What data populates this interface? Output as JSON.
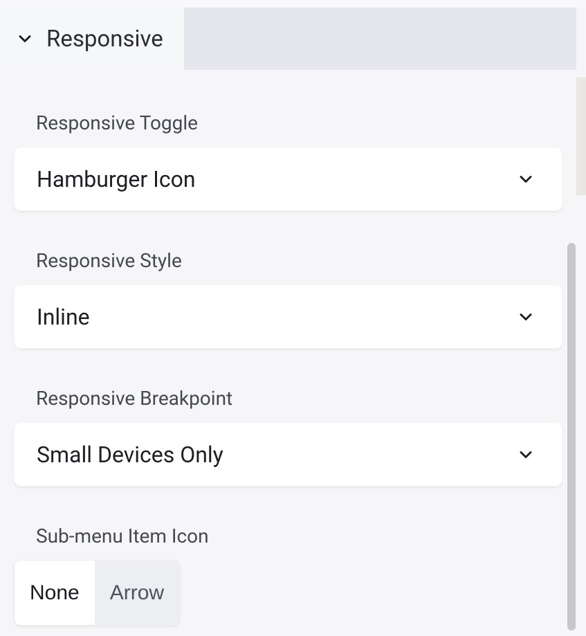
{
  "tab": {
    "label": "Responsive"
  },
  "fields": {
    "toggle": {
      "label": "Responsive Toggle",
      "value": "Hamburger Icon"
    },
    "style": {
      "label": "Responsive Style",
      "value": "Inline"
    },
    "breakpoint": {
      "label": "Responsive Breakpoint",
      "value": "Small Devices Only"
    },
    "submenu": {
      "label": "Sub-menu Item Icon",
      "options": [
        "None",
        "Arrow"
      ],
      "selected": "None"
    }
  }
}
